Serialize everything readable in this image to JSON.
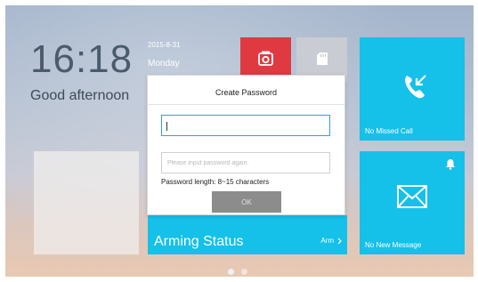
{
  "clock": {
    "time": "16:18",
    "greeting": "Good afternoon",
    "date": "2015-8-31",
    "weekday": "Monday"
  },
  "tiles": {
    "camera": {
      "icon": "camera-icon",
      "color": "#df3a41"
    },
    "sd_card": {
      "icon": "sd-card-icon",
      "color": "#c9ccd2"
    },
    "call": {
      "label": "No Missed Call",
      "icon": "phone-missed-icon",
      "color": "#15c0e9"
    },
    "message": {
      "label": "No New Message",
      "icons": [
        "bell-icon",
        "envelope-icon"
      ],
      "color": "#15c0e9"
    },
    "arming": {
      "label": "Arming Status",
      "link": "Arm",
      "icon": "chevron-right-icon",
      "color": "#15c0e9"
    }
  },
  "dialog": {
    "title": "Create Password",
    "password_value": "",
    "confirm_placeholder": "Please input password again.",
    "hint": "Password length: 8~15 characters",
    "ok_label": "OK"
  },
  "pager": {
    "pages": 2,
    "current": 1
  }
}
